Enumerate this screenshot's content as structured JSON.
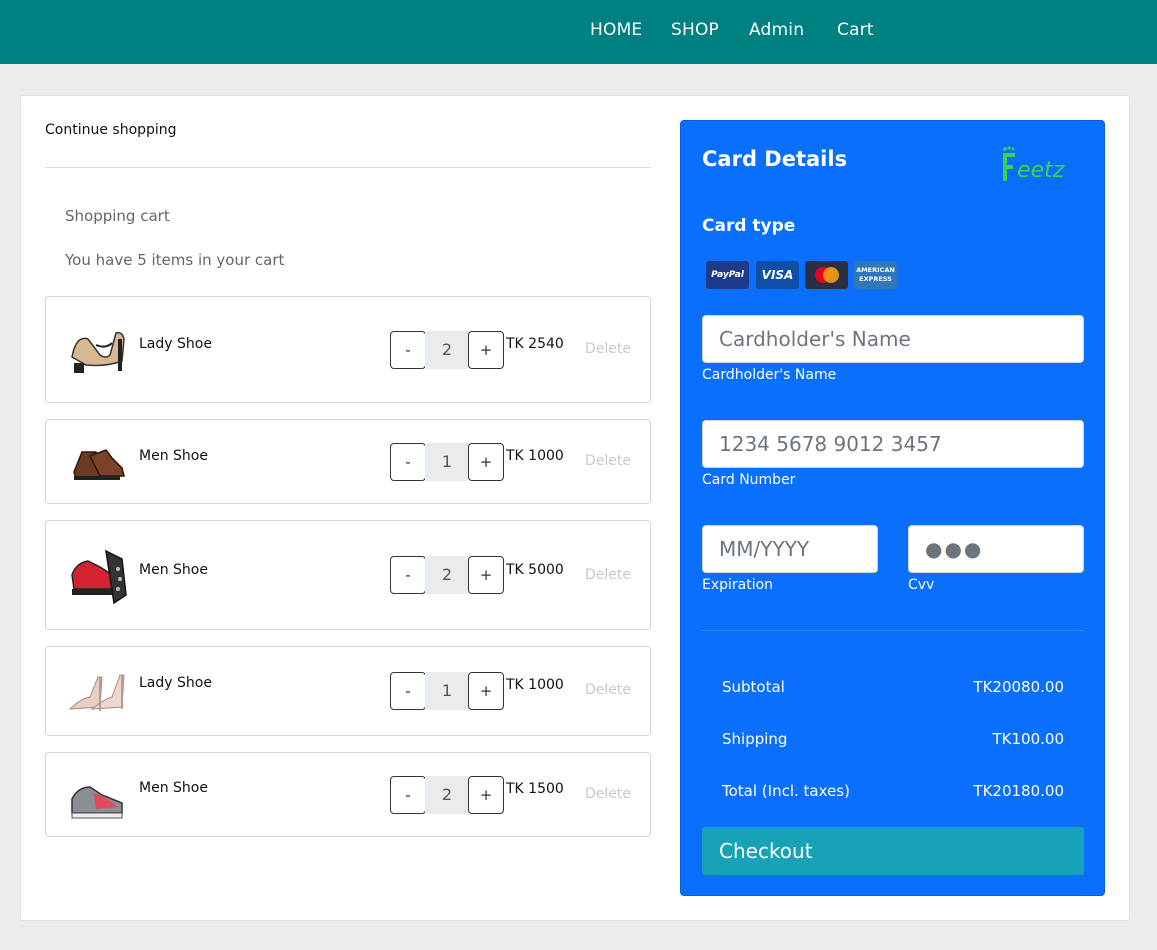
{
  "nav": {
    "home": "HOME",
    "shop": "SHOP",
    "admin": "Admin",
    "cart": "Cart",
    "bg_color": "#008080"
  },
  "cart": {
    "continue_label": "Continue shopping",
    "title": "Shopping cart",
    "count_text": "You have 5 items in your cart",
    "items": [
      {
        "name": "Lady Shoe",
        "qty": "2",
        "price": "TK 2540",
        "delete": "Delete",
        "image": "beige-platform-heel"
      },
      {
        "name": "Men Shoe",
        "qty": "1",
        "price": "TK 1000",
        "delete": "Delete",
        "image": "brown-leather-boot"
      },
      {
        "name": "Men Shoe",
        "qty": "2",
        "price": "TK 5000",
        "delete": "Delete",
        "image": "red-sneaker"
      },
      {
        "name": "Lady Shoe",
        "qty": "1",
        "price": "TK 1000",
        "delete": "Delete",
        "image": "nude-stiletto"
      },
      {
        "name": "Men Shoe",
        "qty": "2",
        "price": "TK 1500",
        "delete": "Delete",
        "image": "grey-red-sneaker"
      }
    ],
    "minus": "-",
    "plus": "+"
  },
  "card": {
    "title": "Card Details",
    "logo_text": "eetz",
    "card_type_label": "Card type",
    "card_types": [
      "PayPal",
      "VISA",
      "Mastercard",
      "AMERICAN EXPRESS"
    ],
    "name_placeholder": "Cardholder's Name",
    "name_label": "Cardholder's Name",
    "number_placeholder": "1234 5678 9012 3457",
    "number_label": "Card Number",
    "exp_placeholder": "MM/YYYY",
    "exp_label": "Expiration",
    "cvv_value": "●●●",
    "cvv_label": "Cvv",
    "subtotal_label": "Subtotal",
    "subtotal_value": "TK20080.00",
    "shipping_label": "Shipping",
    "shipping_value": "TK100.00",
    "total_label": "Total (Incl. taxes)",
    "total_value": "TK20180.00",
    "checkout_label": "Checkout",
    "bg_color": "#0a6ffc",
    "checkout_color": "#17a2b8"
  }
}
